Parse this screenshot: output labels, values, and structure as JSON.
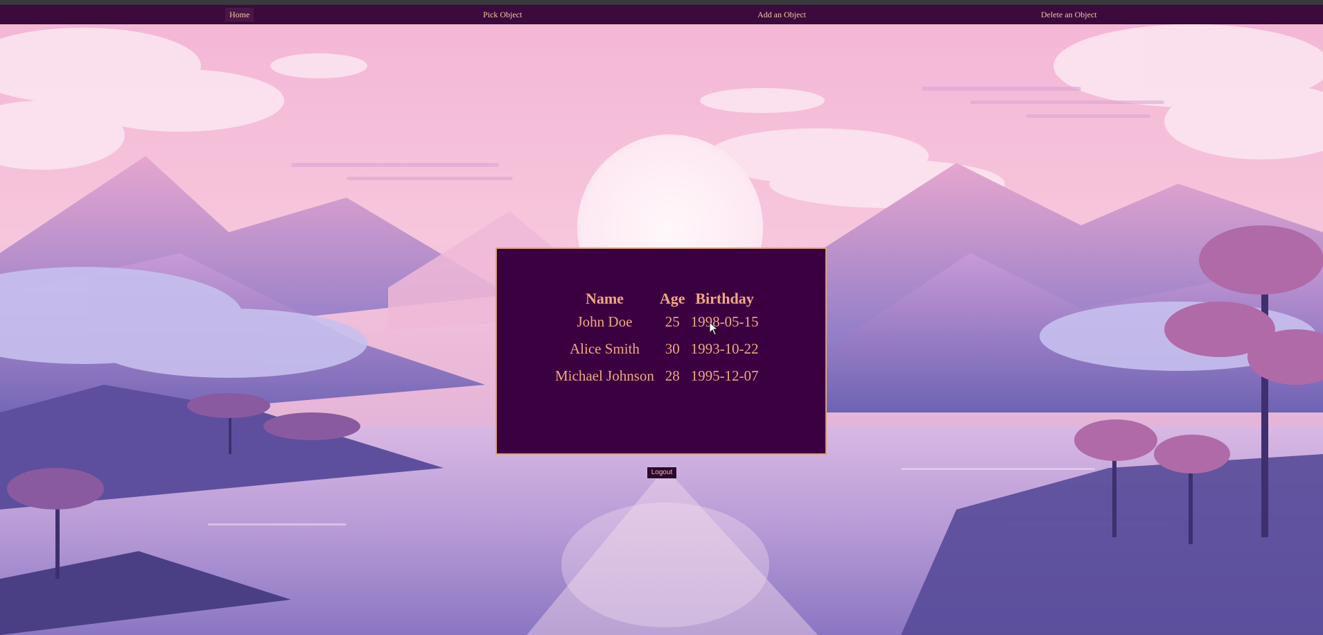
{
  "nav": {
    "items": [
      {
        "label": "Home",
        "active": true
      },
      {
        "label": "Pick Object",
        "active": false
      },
      {
        "label": "Add an Object",
        "active": false
      },
      {
        "label": "Delete an Object",
        "active": false
      }
    ]
  },
  "table": {
    "headers": [
      "Name",
      "Age",
      "Birthday"
    ],
    "rows": [
      [
        "John Doe",
        "25",
        "1998-05-15"
      ],
      [
        "Alice Smith",
        "30",
        "1993-10-22"
      ],
      [
        "Michael Johnson",
        "28",
        "1995-12-07"
      ]
    ]
  },
  "logout_label": "Logout",
  "colors": {
    "nav_bg": "#3c0a3c",
    "nav_text": "#f2c8a8",
    "panel_bg": "#3b0040",
    "panel_border": "#d9a080",
    "table_text": "#f0a884"
  }
}
